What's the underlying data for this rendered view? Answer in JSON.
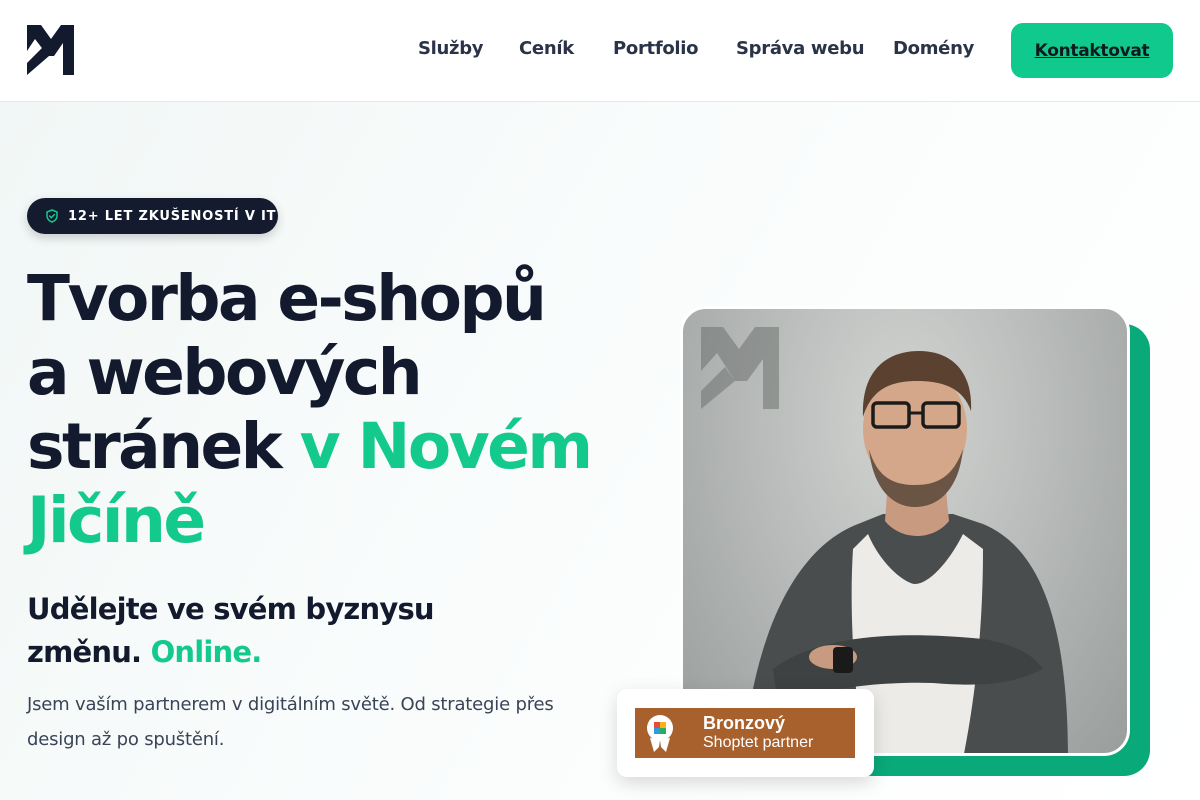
{
  "header": {
    "logo_icon": "m-monogram-logo",
    "nav": [
      "Služby",
      "Ceník",
      "Portfolio",
      "Správa webu",
      "Domény"
    ],
    "cta_label": "Kontaktovat"
  },
  "hero": {
    "badge": {
      "icon": "shield-check-icon",
      "text": "12+ LET ZKUŠENOSTÍ V IT"
    },
    "title": {
      "line1": "Tvorba e-shopů",
      "line2": "a webových",
      "line3_dark": "stránek ",
      "line3_green": "v Novém",
      "line4_green": "Jičíně"
    },
    "subtitle": {
      "line1": "Udělejte ve svém byznysu",
      "line2_dark": "změnu. ",
      "line2_green": "Online."
    },
    "lead": {
      "line1": "Jsem vaším partnerem v digitálním světě. Od strategie přes",
      "line2": "design až po spuštění."
    },
    "partner": {
      "icon": "shoptet-partner-icon",
      "line1": "Bronzový",
      "line2": "Shoptet partner"
    }
  },
  "colors": {
    "accent": "#13c98b",
    "dark": "#141a2e",
    "partner_bronze": "#a8612c"
  }
}
